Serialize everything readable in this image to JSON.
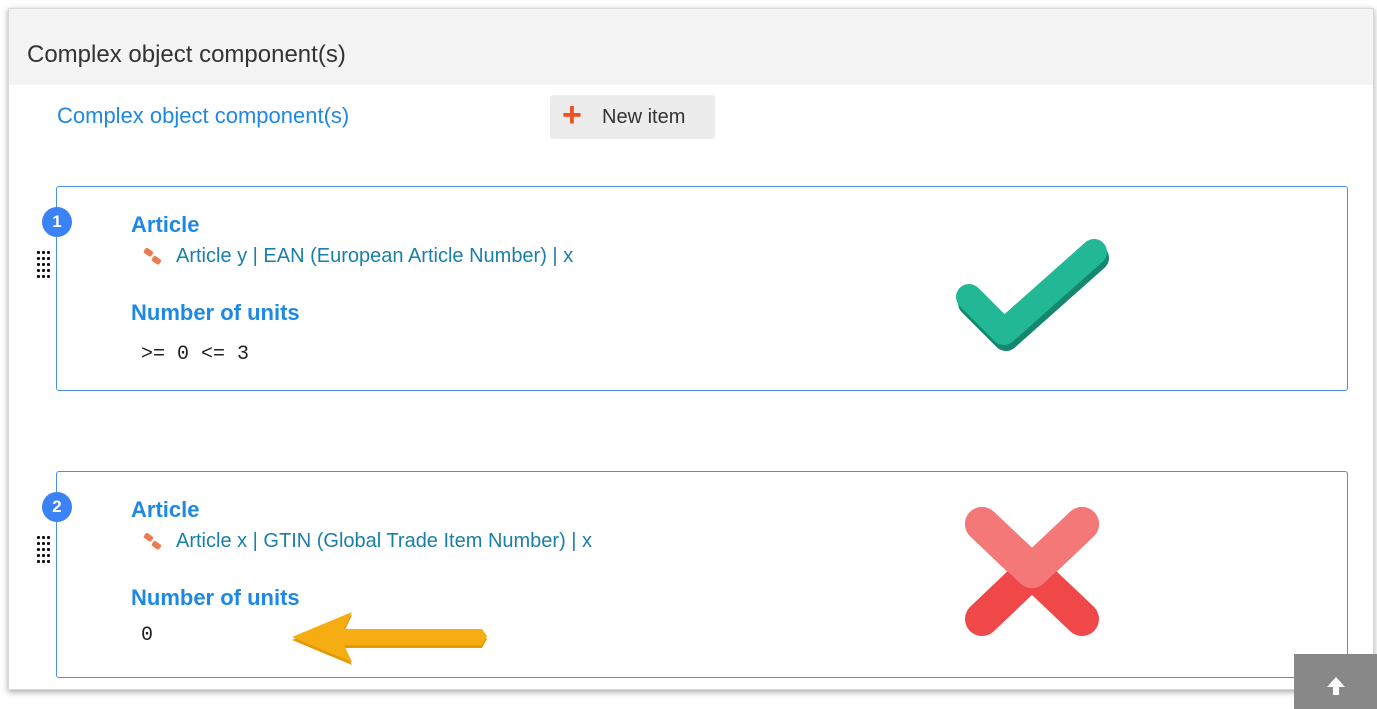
{
  "panel": {
    "title": "Complex object component(s)",
    "section_label": "Complex object component(s)",
    "new_item_label": "New item"
  },
  "items": [
    {
      "index": "1",
      "article_label": "Article",
      "article_ref": "Article y | EAN (European Article Number) | x",
      "units_label": "Number of units",
      "units_value": ">= 0 <= 3",
      "status": "valid-checkmark-icon"
    },
    {
      "index": "2",
      "article_label": "Article",
      "article_ref": "Article x | GTIN (Global Trade Item Number) | x",
      "units_label": "Number of units",
      "units_value": "0",
      "status": "invalid-cross-icon"
    }
  ],
  "icons": {
    "add": "plus-icon",
    "reference": "link-icon",
    "drag": "drag-handle-icon",
    "scroll": "arrow-up-icon",
    "annotation": "arrow-left-icon"
  },
  "colors": {
    "accent": "#1e88e5",
    "badge": "#3b82f6",
    "add_icon": "#f0501e",
    "valid": "#1fae8e",
    "invalid": "#f04848",
    "annotation_arrow": "#f2a70c"
  }
}
